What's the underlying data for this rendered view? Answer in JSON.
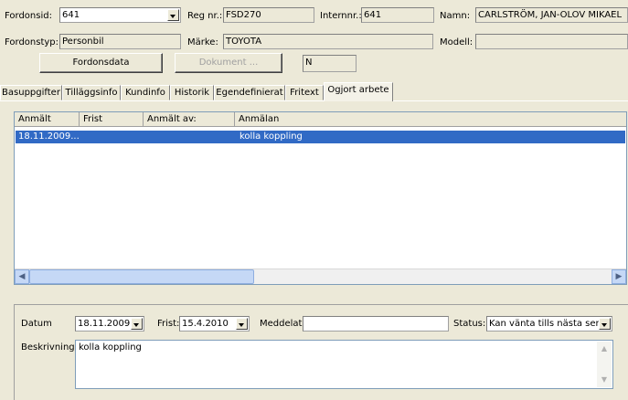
{
  "header": {
    "fordonsid_label": "Fordonsid:",
    "fordonsid_value": "641",
    "regnr_label": "Reg nr.:",
    "regnr_value": "FSD270",
    "internnr_label": "Internnr.:",
    "internnr_value": "641",
    "namn_label": "Namn:",
    "namn_value": "CARLSTRÖM, JAN-OLOV MIKAEL",
    "fordonstyp_label": "Fordonstyp:",
    "fordonstyp_value": "Personbil",
    "marke_label": "Märke:",
    "marke_value": "TOYOTA",
    "modell_label": "Modell:",
    "modell_value": "",
    "fordonsdata_button": "Fordonsdata",
    "dokument_button": "Dokument ...",
    "flag_value": "N"
  },
  "tabs": [
    {
      "label": "Basuppgifter"
    },
    {
      "label": "Tilläggsinfo"
    },
    {
      "label": "Kundinfo"
    },
    {
      "label": "Historik"
    },
    {
      "label": "Egendefinierat"
    },
    {
      "label": "Fritext"
    },
    {
      "label": "Ogjort arbete"
    }
  ],
  "list": {
    "columns": [
      "Anmält",
      "Frist",
      "Anmält av:",
      "Anmälan"
    ],
    "rows": [
      {
        "anmalt": "18.11.2009...",
        "frist": "",
        "anmalt_av": "",
        "anmalan": "kolla koppling",
        "selected": true
      }
    ]
  },
  "detail": {
    "datum_label": "Datum",
    "datum_value": "18.11.2009",
    "frist_label": "Frist:",
    "frist_value": "15.4.2010",
    "meddelat_label": "Meddelat",
    "meddelat_value": "",
    "status_label": "Status:",
    "status_value": "Kan vänta tills nästa ser",
    "beskrivning_label": "Beskrivning:",
    "beskrivning_value": "kolla koppling"
  },
  "colors": {
    "window_bg": "#ece9d8",
    "selection": "#316ac5",
    "border_blue": "#7f9db9"
  }
}
